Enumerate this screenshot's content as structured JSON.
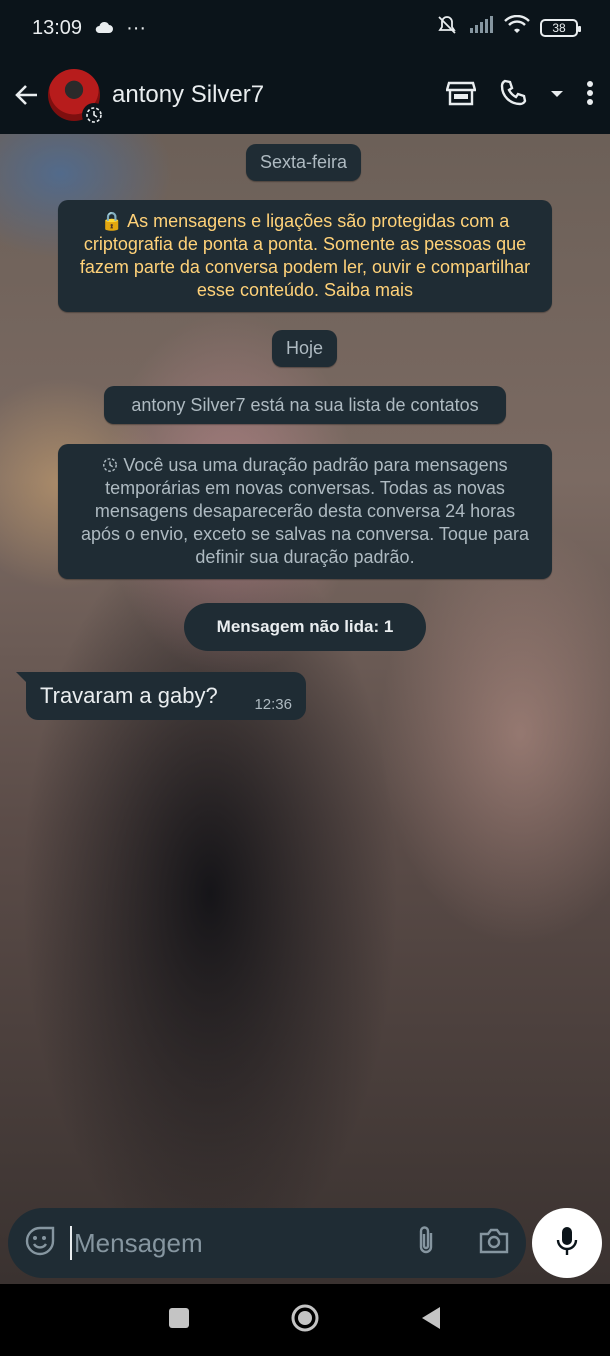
{
  "status_bar": {
    "time": "13:09",
    "more": "···",
    "battery": "38"
  },
  "header": {
    "contact_name": "antony Silver7"
  },
  "chat": {
    "date_divider_1": "Sexta-feira",
    "encryption_notice": "🔒 As mensagens e ligações são protegidas com a criptografia de ponta a ponta. Somente as pessoas que fazem parte da conversa podem ler, ouvir e compartilhar esse conteúdo. Saiba mais",
    "date_divider_2": "Hoje",
    "contact_notice": "antony Silver7 está na sua lista de contatos",
    "ephemeral_notice": "Você usa uma duração padrão para mensagens temporárias em novas conversas. Todas as novas mensagens desaparecerão desta conversa 24 horas após o envio, exceto se salvas na conversa. Toque para definir sua duração padrão.",
    "unread_label": "Mensagem não lida: 1",
    "messages": [
      {
        "text": "Travaram a gaby?",
        "time": "12:36",
        "direction": "incoming"
      }
    ]
  },
  "composer": {
    "placeholder": "Mensagem"
  },
  "colors": {
    "background": "#0b141a",
    "bubble": "#1f2c34",
    "system_text": "#ffd279",
    "muted": "#aebac1"
  }
}
